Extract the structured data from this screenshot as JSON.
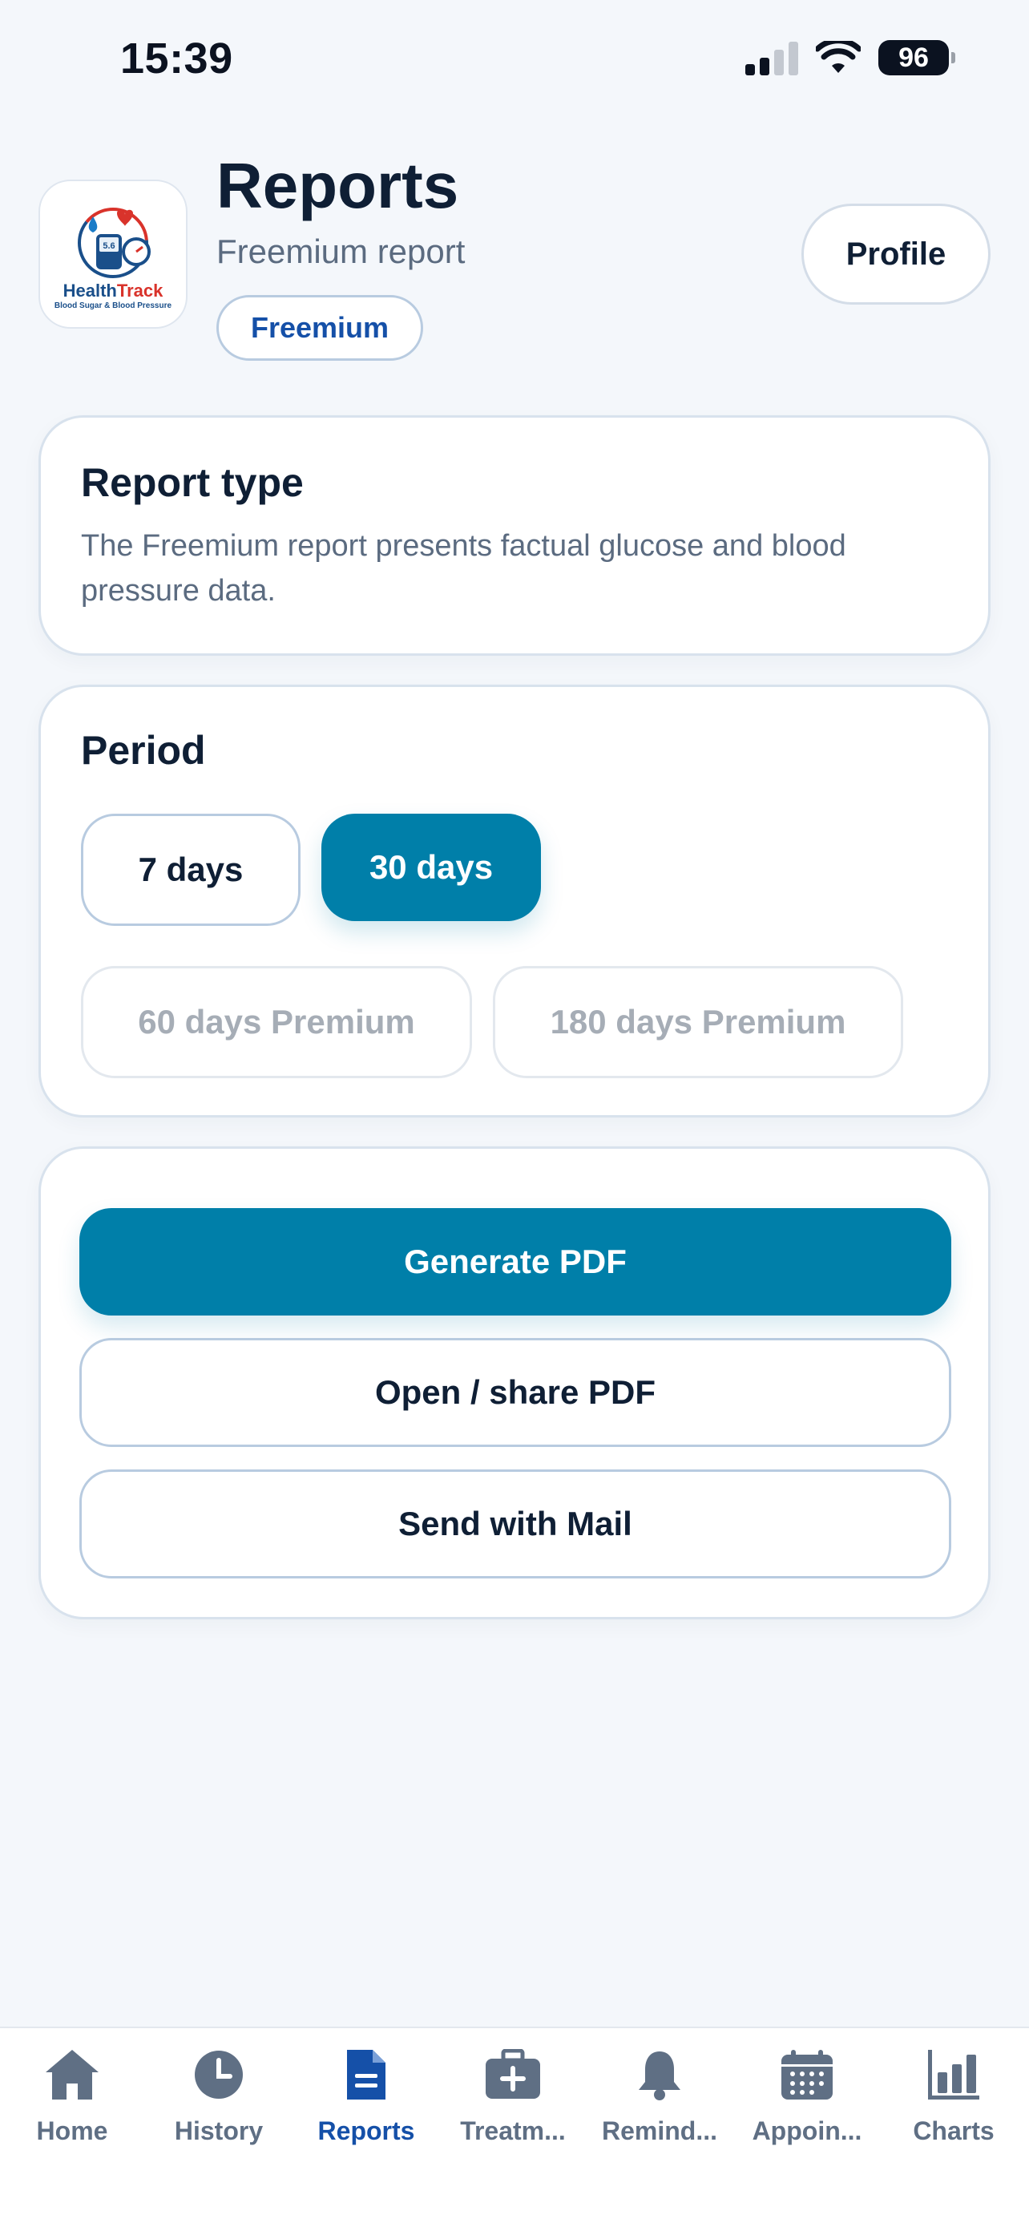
{
  "status_bar": {
    "time": "15:39",
    "battery": "96"
  },
  "header": {
    "logo": {
      "brand_left": "Health",
      "brand_right": "Track",
      "tagline": "Blood Sugar & Blood Pressure"
    },
    "title": "Reports",
    "subtitle": "Freemium report",
    "badge": "Freemium",
    "profile_label": "Profile"
  },
  "report_type": {
    "title": "Report type",
    "description": "The Freemium report presents factual glucose and blood pressure data."
  },
  "period": {
    "title": "Period",
    "options": [
      {
        "label": "7 days",
        "state": "default"
      },
      {
        "label": "30 days",
        "state": "selected"
      },
      {
        "label": "60 days Premium",
        "state": "locked"
      },
      {
        "label": "180 days Premium",
        "state": "locked"
      }
    ]
  },
  "actions": {
    "generate": "Generate PDF",
    "open_share": "Open / share PDF",
    "send_mail": "Send with Mail"
  },
  "tab_bar": {
    "items": [
      {
        "label": "Home",
        "icon": "home-icon"
      },
      {
        "label": "History",
        "icon": "clock-icon"
      },
      {
        "label": "Reports",
        "icon": "document-icon",
        "active": true
      },
      {
        "label": "Treatm...",
        "icon": "medkit-icon"
      },
      {
        "label": "Remind...",
        "icon": "bell-icon"
      },
      {
        "label": "Appoin...",
        "icon": "calendar-icon"
      },
      {
        "label": "Charts",
        "icon": "bar-chart-icon"
      }
    ]
  },
  "colors": {
    "accent": "#007fa9",
    "active_tab": "#1550a8",
    "background": "#f4f7fb",
    "text_primary": "#0f1f35",
    "text_secondary": "#5b6b80"
  }
}
